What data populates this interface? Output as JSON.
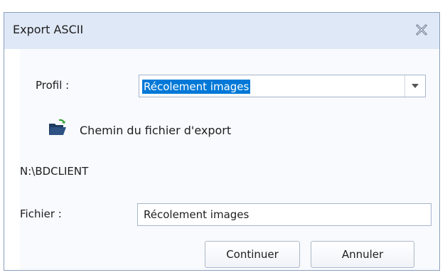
{
  "window": {
    "title": "Export ASCII"
  },
  "profile": {
    "label": "Profil :",
    "selected": "Récolement images"
  },
  "export_path": {
    "link_label": "Chemin du fichier d'export",
    "value": "N:\\BDCLIENT"
  },
  "file": {
    "label": "Fichier :",
    "value": "Récolement images"
  },
  "buttons": {
    "continue": "Continuer",
    "cancel": "Annuler"
  },
  "icons": {
    "close": "close-icon",
    "folder": "folder-open-icon",
    "dropdown": "chevron-down-icon"
  },
  "colors": {
    "titlebar": "#dfe8f6",
    "border": "#8b9fbe",
    "selection": "#0078d7",
    "content_bg": "#f8fafd"
  }
}
